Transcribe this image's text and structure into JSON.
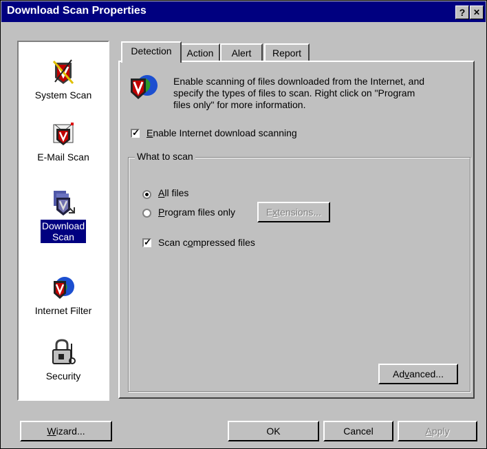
{
  "window": {
    "title": "Download Scan Properties",
    "help_glyph": "?",
    "close_glyph": "✕"
  },
  "sidebar": {
    "items": [
      {
        "label": "System Scan",
        "icon": "system-scan-icon",
        "selected": false
      },
      {
        "label": "E-Mail Scan",
        "icon": "email-scan-icon",
        "selected": false
      },
      {
        "label_line1": "Download",
        "label_line2": "Scan",
        "icon": "download-scan-icon",
        "selected": true
      },
      {
        "label": "Internet Filter",
        "icon": "internet-filter-icon",
        "selected": false
      },
      {
        "label": "Security",
        "icon": "security-lock-icon",
        "selected": false
      }
    ]
  },
  "tabs": [
    {
      "label": "Detection",
      "active": true
    },
    {
      "label": "Action",
      "active": false
    },
    {
      "label": "Alert",
      "active": false
    },
    {
      "label": "Report",
      "active": false
    }
  ],
  "detection": {
    "description_line1": "Enable scanning of files downloaded from the Internet, and",
    "description_line2": "specify the types of files to scan. Right click on \"Program",
    "description_line3": "files only\" for more information.",
    "enable_checkbox": {
      "label_prefix": "",
      "label_accel": "E",
      "label_rest": "nable Internet download scanning",
      "checked": true
    },
    "group_label": "What to scan",
    "radio_all": {
      "label_accel": "A",
      "label_rest": "ll files",
      "selected": true
    },
    "radio_program": {
      "label_accel": "P",
      "label_rest": "rogram files only",
      "selected": false
    },
    "extensions_button": {
      "label_prefix": "E",
      "label_accel": "x",
      "label_rest": "tensions..."
    },
    "compressed_checkbox": {
      "label_prefix": "Scan c",
      "label_accel": "o",
      "label_rest": "mpressed files",
      "checked": true
    },
    "advanced_button": {
      "label_prefix": "Ad",
      "label_accel": "v",
      "label_rest": "anced..."
    }
  },
  "footer": {
    "wizard_button": {
      "label_accel": "W",
      "label_rest": "izard..."
    },
    "ok_label": "OK",
    "cancel_label": "Cancel",
    "apply_button": {
      "label_accel": "A",
      "label_rest": "pply"
    }
  },
  "colors": {
    "titlebar": "#000080",
    "face": "#c0c0c0",
    "selection": "#000080",
    "shield_red": "#c00000",
    "globe_blue": "#1c4fd0"
  }
}
